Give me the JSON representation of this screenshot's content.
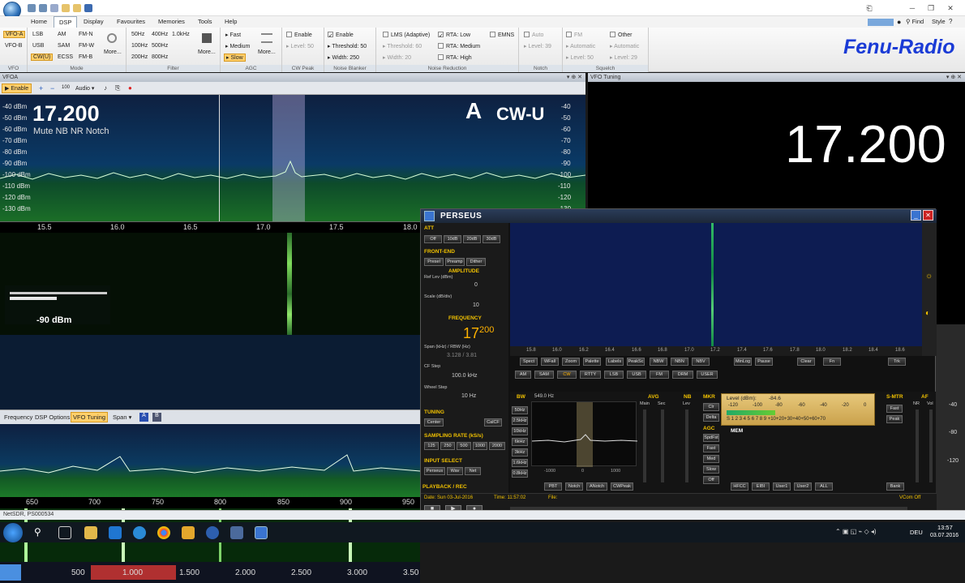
{
  "ribbon_tabs": [
    "Home",
    "DSP",
    "Display",
    "Favourites",
    "Memories",
    "Tools",
    "Help"
  ],
  "ribbon_right": {
    "find": "Find",
    "style": "Style"
  },
  "vfo_group": {
    "items": [
      "VFO-A",
      "VFO-B"
    ],
    "name": "VFO"
  },
  "mode_group": {
    "cols": [
      [
        "LSB",
        "USB",
        "CW(U)"
      ],
      [
        "AM",
        "SAM",
        "ECSS"
      ],
      [
        "FM-N",
        "FM-W",
        "FM-B"
      ]
    ],
    "more": "More...",
    "name": "Mode"
  },
  "filter_group": {
    "cols": [
      [
        "50Hz",
        "100Hz",
        "200Hz"
      ],
      [
        "400Hz",
        "500Hz",
        "800Hz"
      ],
      [
        "1.0kHz"
      ]
    ],
    "more": "More...",
    "name": "Filter"
  },
  "agc_group": {
    "items": [
      "Fast",
      "Medium",
      "Slow"
    ],
    "more": "More...",
    "name": "AGC"
  },
  "cwpeak_group": {
    "enable": "Enable",
    "level": "Level: 50",
    "name": "CW Peak"
  },
  "nb_group": {
    "enable": "Enable",
    "threshold": "Threshold: 50",
    "width": "Width: 250",
    "name": "Noise Blanker"
  },
  "nr_group": {
    "lms": "LMS (Adaptive)",
    "threshold": "Threshold: 60",
    "width": "Width: 20",
    "rta_low": "RTA: Low",
    "rta_med": "RTA: Medium",
    "rta_high": "RTA: High",
    "emns": "EMNS",
    "name": "Noise Reduction"
  },
  "notch_group": {
    "auto": "Auto",
    "level": "Level: 39",
    "name": "Notch"
  },
  "squelch_group": {
    "fm": "FM",
    "automatic1": "Automatic",
    "level1": "Level: 50",
    "other": "Other",
    "automatic2": "Automatic",
    "level2": "Level: 29",
    "name": "Squelch"
  },
  "brand": "Fenu-Radio",
  "vfoa": {
    "title": "VFOA",
    "enable": "Enable",
    "audio": "Audio",
    "freq": "17.200",
    "flags": "Mute NB NR Notch",
    "vfo_letter": "A",
    "mode": "CW-U",
    "dbm_labels": [
      "-40 dBm",
      "-50 dBm",
      "-60 dBm",
      "-70 dBm",
      "-80 dBm",
      "-90 dBm",
      "-100 dBm",
      "-110 dBm",
      "-120 dBm",
      "-130 dBm"
    ],
    "dbm_right": [
      "-40",
      "-50",
      "-60",
      "-70",
      "-80",
      "-90",
      "-100",
      "-110",
      "-120",
      "-130"
    ],
    "scale": [
      "15.5",
      "16.0",
      "16.5",
      "17.0",
      "17.5",
      "18.0"
    ],
    "smeter_value": "-90 dBm",
    "subtabs": [
      "Frequency",
      "DSP Options",
      "VFO Tuning",
      "Span"
    ],
    "scale2": [
      "650",
      "700",
      "750",
      "800",
      "850",
      "900",
      "950"
    ],
    "scale3": [
      "500",
      "1.000",
      "1.500",
      "2.000",
      "2.500",
      "3.000",
      "3.50"
    ]
  },
  "vfo_tuning": {
    "title": "VFO Tuning",
    "freq": "17.200"
  },
  "perseus": {
    "title": "PERSEUS",
    "att": "ATT",
    "att_btns": [
      "Off",
      "10dB",
      "20dB",
      "30dB"
    ],
    "front_end": "FRONT-END",
    "fe_btns": [
      "Presel",
      "Preamp",
      "Dither"
    ],
    "amplitude": "AMPLITUDE",
    "ref_lev": "Ref Lev (dBm)",
    "ref_val": "0",
    "scale_lab": "Scale (dB/div)",
    "scale_val": "10",
    "frequency": "FREQUENCY",
    "freq_main": "17",
    "freq_dec": "200",
    "span_lab": "Span (kHz) / RBW (Hz)",
    "span_val": "3.128 / 3.81",
    "cfstep_lab": "CF Step",
    "cfstep_val": "100.0 kHz",
    "wheel_lab": "Wheel Step",
    "wheel_val": "10 Hz",
    "tuning": "TUNING",
    "tuning_btns": [
      "Center",
      "CalCF"
    ],
    "sampling": "SAMPLING RATE (kS/s)",
    "sr_btns": [
      "125",
      "250",
      "500",
      "1000",
      "2000"
    ],
    "input": "INPUT SELECT",
    "input_btns": [
      "Perseus",
      "Wav",
      "Net"
    ],
    "playback": "PLAYBACK / REC",
    "date": "Date: Sun 03-Jul-2016",
    "time": "Time:  11:57:02",
    "file": "File:",
    "vcom": "VCom Off",
    "scale": [
      "15.8",
      "16.0",
      "16.2",
      "16.4",
      "16.6",
      "16.8",
      "17.0",
      "17.2",
      "17.4",
      "17.6",
      "17.8",
      "18.0",
      "18.2",
      "18.4",
      "18.6"
    ],
    "toolbar_btns": [
      "Spect",
      "WFall",
      "Zoom",
      "Palette",
      "Labels",
      "PeakSc",
      "NBW",
      "NBN",
      "NBV",
      "",
      "MinLog",
      "Pause",
      "Clear",
      "Fn",
      "Trk"
    ],
    "modes": [
      "AM",
      "SAM",
      "CW",
      "RTTY",
      "LSB",
      "USB",
      "FM",
      "DRM",
      "USER"
    ],
    "bw": "BW",
    "bw_val": "549.0 Hz",
    "bw_btns": [
      "50Hz",
      "2.5kHz",
      "10kHz",
      "6kHz",
      "3kHz",
      "1.6kHz",
      "0.8kHz"
    ],
    "bw_scale": [
      "-1000",
      "0",
      "1000"
    ],
    "avg": "AVG",
    "avg_sub": [
      "Main",
      "Sec"
    ],
    "nb": "NB",
    "nb_sub": "Lev",
    "mkr": "MKR",
    "mkr_btns": [
      "Clr",
      "Delta"
    ],
    "agc": "AGC",
    "agc_btns": [
      "SpdFst",
      "Fast",
      "Med",
      "Slow",
      "Off"
    ],
    "level_lab": "Level (dBm):",
    "level_val": "-84.6",
    "lvl_ticks": [
      "-120",
      "-100",
      "-80",
      "-60",
      "-40",
      "-20",
      "0"
    ],
    "s_ticks": "S 1 2 3 4 5 6 7 8 9 +10+20+30+40+50+60+70",
    "smtr": "S-MTR",
    "smtr_btns": [
      "Fast",
      "Peak"
    ],
    "af": "AF",
    "af_sub": [
      "NR",
      "Vol"
    ],
    "mem": "MEM",
    "lower_btns": [
      "PBT",
      "Notch",
      "ANotch",
      "CWPeak",
      "HFCC",
      "EIBI",
      "User1",
      "User2",
      "ALL",
      "Bank"
    ]
  },
  "right_strip": [
    "-40",
    "-80",
    "-120"
  ],
  "status_text": "NetSDR, PS000534",
  "taskbar": {
    "time": "13:57",
    "date": "03.07.2016",
    "lang": "DEU"
  }
}
